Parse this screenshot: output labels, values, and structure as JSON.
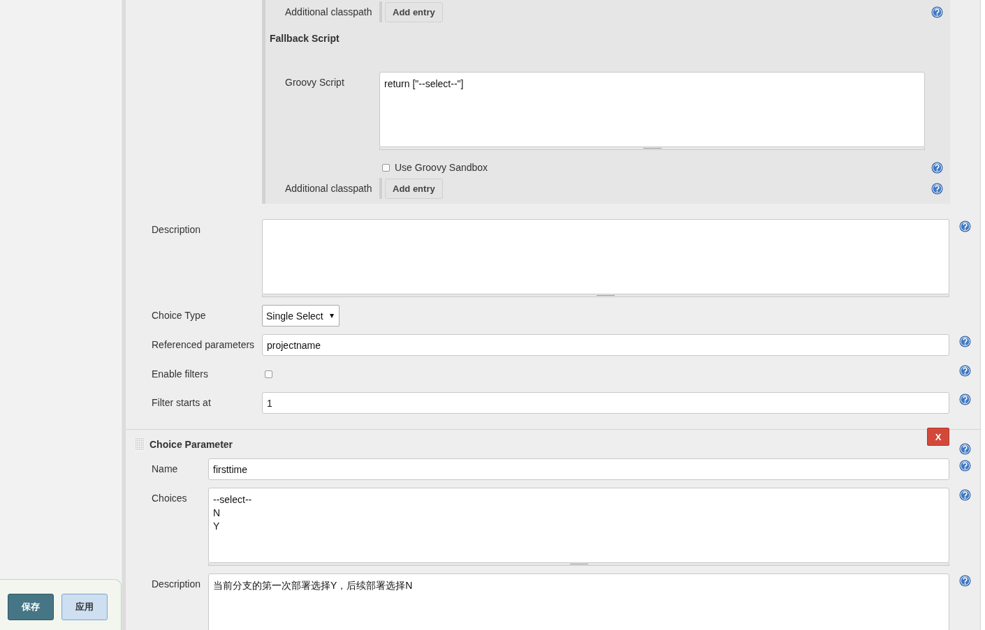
{
  "script_section": {
    "rows": [
      {
        "kind": "classpath",
        "label": "Additional classpath",
        "button": "Add entry",
        "help": true
      },
      {
        "kind": "heading",
        "label": "Fallback Script"
      },
      {
        "kind": "textarea",
        "label": "Groovy Script",
        "value": "return [\"--select--\"]",
        "help": false
      },
      {
        "kind": "checkbox",
        "label": "Use Groovy Sandbox",
        "checked": false,
        "help": true
      },
      {
        "kind": "classpath",
        "label": "Additional classpath",
        "button": "Add entry",
        "help": true
      }
    ]
  },
  "fields": [
    {
      "kind": "textarea",
      "label": "Description",
      "help": true
    },
    {
      "kind": "select",
      "label": "Choice Type",
      "value": "Single Select",
      "help": false
    },
    {
      "kind": "input",
      "label": "Referenced parameters",
      "value": "projectname",
      "help": true
    },
    {
      "kind": "checkbox",
      "label": "Enable filters",
      "checked": false,
      "help": true
    },
    {
      "kind": "input",
      "label": "Filter starts at",
      "value": "1",
      "help": true
    }
  ],
  "choice_parameter": {
    "title": "Choice Parameter",
    "delete_button": "X",
    "help": true,
    "fields": [
      {
        "kind": "input",
        "label": "Name",
        "value": "firsttime",
        "help": true
      },
      {
        "kind": "textarea",
        "label": "Choices",
        "value": "--select--\nN\nY",
        "help": true
      },
      {
        "kind": "textarea",
        "label": "Description",
        "value": "当前分支的第一次部署选择Y，后续部署选择N",
        "help": true
      }
    ]
  },
  "footer": {
    "buttons": [
      {
        "kind": "primary",
        "label": "保存"
      },
      {
        "kind": "secondary",
        "label": "应用"
      }
    ]
  }
}
